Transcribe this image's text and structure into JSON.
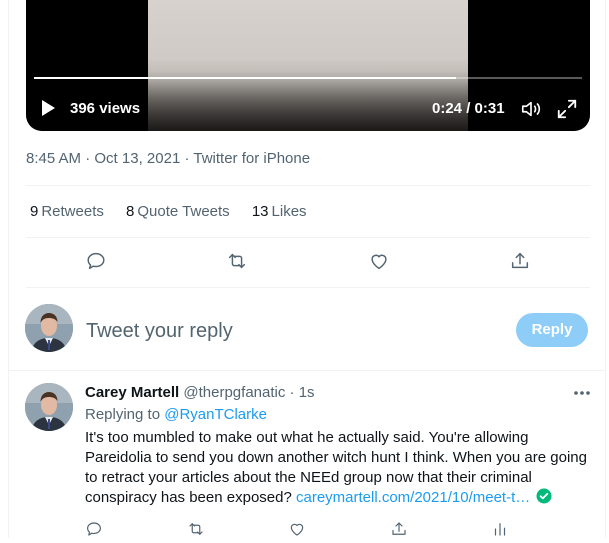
{
  "video": {
    "views_label": "396 views",
    "current_time": "0:24",
    "duration": "0:31",
    "time_separator": " / ",
    "progress_fraction": 0.77
  },
  "tweet_meta": {
    "time": "8:45 AM",
    "date": "Oct 13, 2021",
    "source": "Twitter for iPhone",
    "separator": " · "
  },
  "stats": {
    "retweets": {
      "count": "9",
      "label": "Retweets"
    },
    "quote_tweets": {
      "count": "8",
      "label": "Quote Tweets"
    },
    "likes": {
      "count": "13",
      "label": "Likes"
    }
  },
  "actions": {
    "icons": [
      "reply-icon",
      "retweet-icon",
      "like-icon",
      "share-icon"
    ]
  },
  "reply_box": {
    "placeholder": "Tweet your reply",
    "button_label": "Reply",
    "button_color": "#8ecdf8"
  },
  "reply_tweet": {
    "name": "Carey Martell",
    "handle": "@therpgfanatic",
    "separator": " · ",
    "time": "1s",
    "replying_prefix": "Replying to ",
    "replying_to": "@RyanTClarke",
    "body": "It's too mumbled to make out what he actually said. You're allowing Pareidolia to send you down another witch hunt I think. When you are going to retract your articles about the NEEd group now that their criminal conspiracy has been exposed? ",
    "link": "careymartell.com/2021/10/meet-t…"
  },
  "colors": {
    "accent": "#1d9bf0",
    "secondary_text": "#536471",
    "verified_green": "#00ba7c"
  }
}
